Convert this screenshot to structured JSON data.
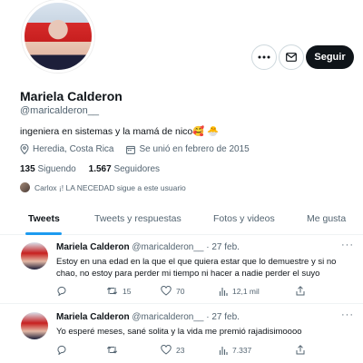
{
  "profile": {
    "name": "Mariela Calderon",
    "handle": "@maricalderon__",
    "bio": "ingeniera en sistemas y la mamá de nico🥰 🐣",
    "location": "Heredia, Costa Rica",
    "joined": "Se unió en febrero de 2015",
    "following_count": "135",
    "following_label": "Siguendo",
    "followers_count": "1.567",
    "followers_label": "Seguidores",
    "followed_by": "Carlox ¡! LA NECEDAD sigue a este usuario"
  },
  "header": {
    "follow_label": "Seguir",
    "more_icon": "more-icon",
    "message_icon": "mail-icon"
  },
  "tabs": [
    {
      "label": "Tweets"
    },
    {
      "label": "Tweets y respuestas"
    },
    {
      "label": "Fotos y videos"
    },
    {
      "label": "Me gusta"
    }
  ],
  "tweets": [
    {
      "name": "Mariela Calderon",
      "handle": "@maricalderon__",
      "date": "· 27 feb.",
      "text_line1": "Estoy en una edad en la que el que quiera estar que lo demuestre y si no",
      "text_line2": "chao, no estoy para perder mi tiempo ni hacer a nadie perder el suyo",
      "retweets": "15",
      "likes": "70",
      "views": "12,1 mil"
    },
    {
      "name": "Mariela Calderon",
      "handle": "@maricalderon__",
      "date": "· 27 feb.",
      "text_line1": "Yo esperé meses, sané solita y la vida me premió rajadisimoooo",
      "retweets": "",
      "likes": "23",
      "views": "7.337"
    }
  ],
  "colors": {
    "accent": "#1d9bf0",
    "text": "#0f1419",
    "muted": "#536471"
  }
}
